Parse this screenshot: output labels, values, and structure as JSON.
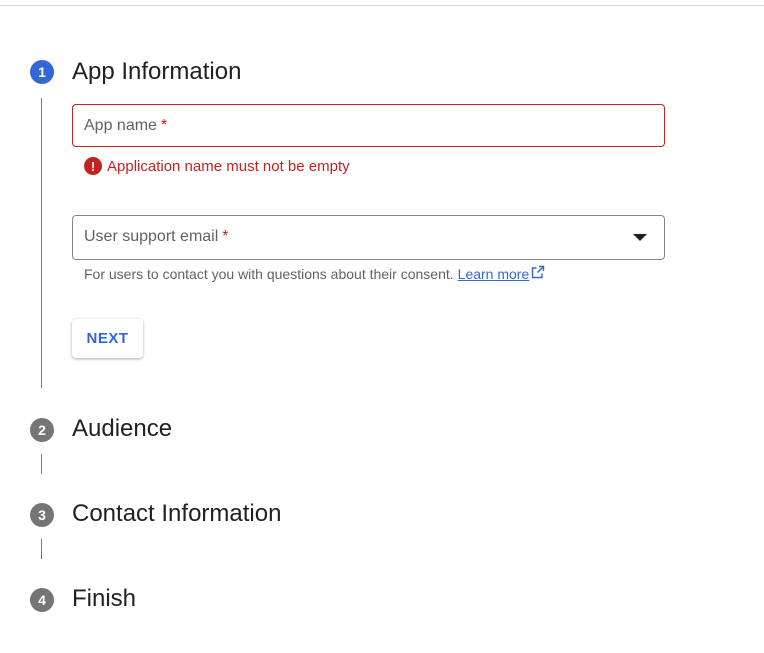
{
  "steps": [
    {
      "number": "1",
      "title": "App Information",
      "state": "active"
    },
    {
      "number": "2",
      "title": "Audience",
      "state": "inactive"
    },
    {
      "number": "3",
      "title": "Contact Information",
      "state": "inactive"
    },
    {
      "number": "4",
      "title": "Finish",
      "state": "inactive"
    }
  ],
  "form": {
    "app_name": {
      "label": "App name",
      "required_marker": "*",
      "value": "",
      "error": "Application name must not be empty",
      "error_icon": "!"
    },
    "support_email": {
      "label": "User support email",
      "required_marker": "*",
      "value": "",
      "hint": "For users to contact you with questions about their consent.",
      "learn_more": "Learn more"
    },
    "next_label": "NEXT"
  },
  "colors": {
    "accent": "#3367d6",
    "error": "#c5221f",
    "inactive_step": "#757575"
  },
  "icons": {
    "error": "error-circle-icon",
    "dropdown": "dropdown-arrow-icon",
    "external": "open-in-new-icon"
  }
}
